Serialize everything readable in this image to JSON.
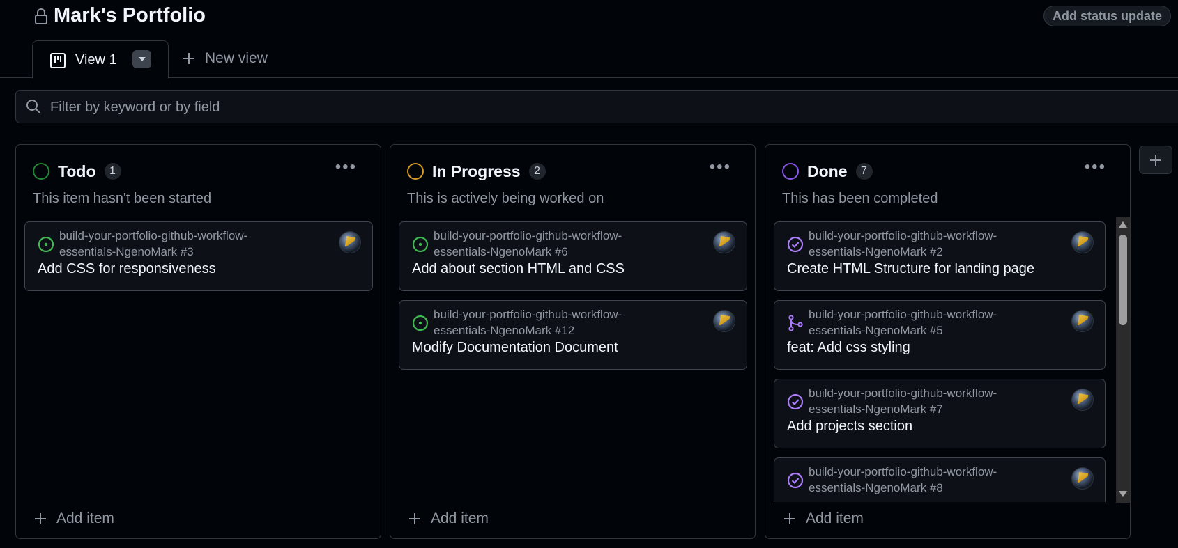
{
  "header": {
    "title": "Mark's Portfolio",
    "status_button": "Add status update",
    "lock_icon": "lock-icon"
  },
  "tabs": {
    "active_label": "View 1",
    "active_icon": "board-icon",
    "new_view_label": "New view"
  },
  "filter": {
    "placeholder": "Filter by keyword or by field"
  },
  "columns": [
    {
      "name": "Todo",
      "count": "1",
      "description": "This item hasn't been started",
      "status_color": "#238636",
      "add_label": "Add item",
      "cards": [
        {
          "repo": "build-your-portfolio-github-workflow-essentials-NgenoMark #3",
          "title": "Add CSS for responsiveness",
          "icon": "open-issue-icon",
          "icon_color": "#3fb950"
        }
      ]
    },
    {
      "name": "In Progress",
      "count": "2",
      "description": "This is actively being worked on",
      "status_color": "#d29922",
      "add_label": "Add item",
      "cards": [
        {
          "repo": "build-your-portfolio-github-workflow-essentials-NgenoMark #6",
          "title": "Add about section HTML and CSS",
          "icon": "open-issue-icon",
          "icon_color": "#3fb950"
        },
        {
          "repo": "build-your-portfolio-github-workflow-essentials-NgenoMark #12",
          "title": "Modify Documentation Document",
          "icon": "open-issue-icon",
          "icon_color": "#3fb950"
        }
      ]
    },
    {
      "name": "Done",
      "count": "7",
      "description": "This has been completed",
      "status_color": "#8957e5",
      "add_label": "Add item",
      "cards": [
        {
          "repo": "build-your-portfolio-github-workflow-essentials-NgenoMark #2",
          "title": "Create HTML Structure for landing page",
          "icon": "closed-issue-icon",
          "icon_color": "#ab7df8"
        },
        {
          "repo": "build-your-portfolio-github-workflow-essentials-NgenoMark #5",
          "title": "feat: Add css styling",
          "icon": "merged-pr-icon",
          "icon_color": "#ab7df8"
        },
        {
          "repo": "build-your-portfolio-github-workflow-essentials-NgenoMark #7",
          "title": "Add projects section",
          "icon": "closed-issue-icon",
          "icon_color": "#ab7df8"
        },
        {
          "repo": "build-your-portfolio-github-workflow-essentials-NgenoMark #8",
          "title": "",
          "icon": "closed-issue-icon",
          "icon_color": "#ab7df8"
        }
      ]
    }
  ]
}
